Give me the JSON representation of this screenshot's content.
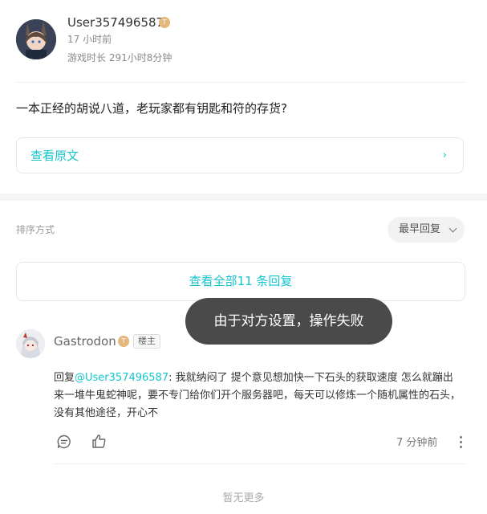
{
  "post": {
    "author": "User357496587",
    "author_badge": "T",
    "time": "17 小时前",
    "playtime": "游戏时长 291小时8分钟",
    "text": "一本正经的胡说八道，老玩家都有钥匙和符的存货?",
    "view_original": "查看原文",
    "view_original_chevron": "›"
  },
  "sort": {
    "label": "排序方式",
    "selected": "最早回复"
  },
  "view_all_replies": "查看全部11 条回复",
  "toast": "由于对方设置，操作失败",
  "reply": {
    "author": "Gastrodon",
    "author_badge": "T",
    "op_tag": "楼主",
    "prefix": "回复",
    "mention": "@User357496587",
    "body": ": 我就纳闷了 提个意见想加快一下石头的获取速度 怎么就蹦出来一堆牛鬼蛇神呢，要不专门给你们开个服务器吧，每天可以修炼一个随机属性的石头，没有其他途径，开心不",
    "time": "7 分钟前"
  },
  "footer": "暂无更多",
  "colors": {
    "accent": "#15c5ce",
    "badge": "#e4b77c",
    "toast_bg": "#404040"
  },
  "icons": {
    "comment": "comment-icon",
    "like": "thumbs-up-icon",
    "more": "more-vertical-icon",
    "chevron_right": "chevron-right-icon",
    "chevron_down": "chevron-down-icon"
  }
}
